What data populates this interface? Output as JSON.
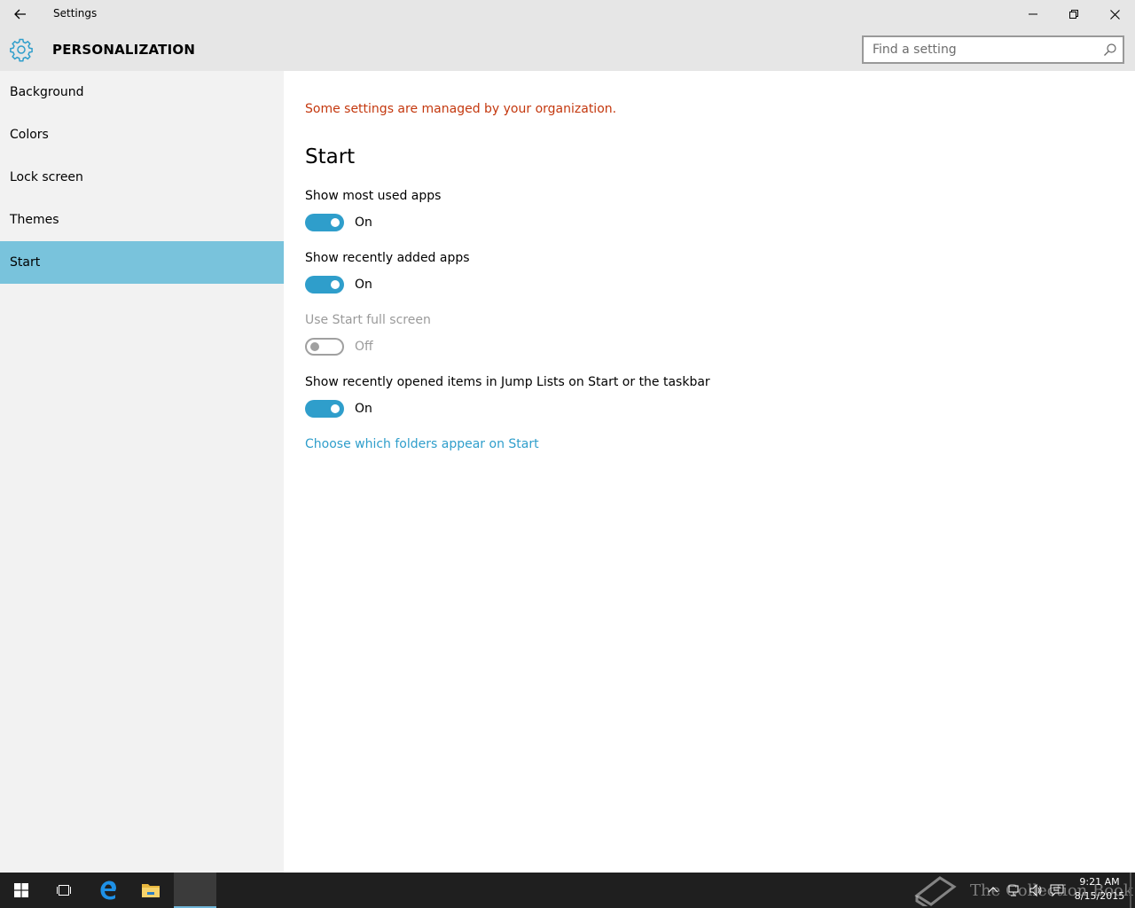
{
  "titlebar": {
    "title": "Settings",
    "back_icon": "back-arrow-icon",
    "controls": [
      "minimize-icon",
      "restore-icon",
      "close-icon"
    ]
  },
  "header": {
    "icon": "gear-icon",
    "section": "PERSONALIZATION",
    "search_placeholder": "Find a setting",
    "search_value": ""
  },
  "sidebar": {
    "items": [
      {
        "label": "Background",
        "selected": false
      },
      {
        "label": "Colors",
        "selected": false
      },
      {
        "label": "Lock screen",
        "selected": false
      },
      {
        "label": "Themes",
        "selected": false
      },
      {
        "label": "Start",
        "selected": true
      }
    ]
  },
  "content": {
    "managed_note": "Some settings are managed by your organization.",
    "heading": "Start",
    "settings": [
      {
        "label": "Show most used apps",
        "state": "On",
        "on": true,
        "disabled": false
      },
      {
        "label": "Show recently added apps",
        "state": "On",
        "on": true,
        "disabled": false
      },
      {
        "label": "Use Start full screen",
        "state": "Off",
        "on": false,
        "disabled": true
      },
      {
        "label": "Show recently opened items in Jump Lists on Start or the taskbar",
        "state": "On",
        "on": true,
        "disabled": false
      }
    ],
    "folders_link": "Choose which folders appear on Start"
  },
  "taskbar": {
    "items": [
      "windows-start-icon",
      "task-view-icon",
      "edge-browser-icon",
      "file-explorer-icon",
      "settings-app"
    ],
    "tray": [
      "chevron-up-icon",
      "network-icon",
      "volume-icon",
      "action-center-icon"
    ],
    "time": "9:21 AM",
    "date": "8/15/2015",
    "watermark": "The Collection Book"
  },
  "colors": {
    "accent": "#2f9ecb",
    "selected_nav": "#79c3dc",
    "warning": "#c4380e"
  }
}
